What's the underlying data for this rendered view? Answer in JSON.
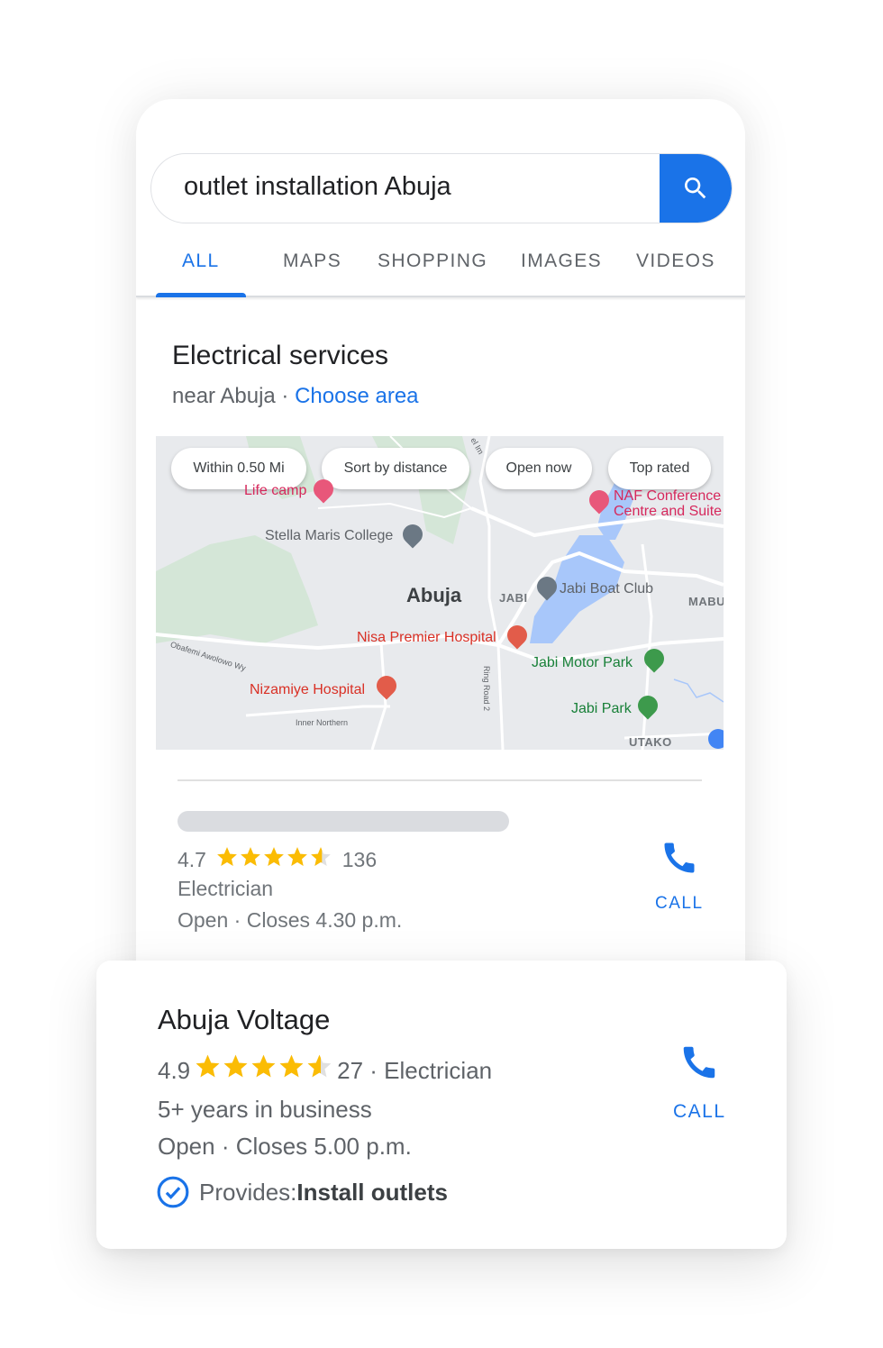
{
  "search": {
    "query": "outlet installation Abuja",
    "button_icon": "search-icon"
  },
  "tabs": [
    {
      "label": "ALL",
      "active": true
    },
    {
      "label": "MAPS",
      "active": false
    },
    {
      "label": "SHOPPING",
      "active": false
    },
    {
      "label": "IMAGES",
      "active": false
    },
    {
      "label": "VIDEOS",
      "active": false
    }
  ],
  "section": {
    "title": "Electrical services",
    "near_text": "near Abuja · ",
    "choose_area": "Choose area"
  },
  "map": {
    "chips": [
      "Within 0.50 Mi",
      "Sort by distance",
      "Open now",
      "Top rated"
    ],
    "places": {
      "life_camp": "Life camp",
      "naf_line1": "NAF Conference",
      "naf_line2": "Centre and Suite",
      "stella": "Stella Maris College",
      "abuja": "Abuja",
      "jabi": "JABI",
      "jabi_boat": "Jabi Boat Club",
      "mabu": "MABU",
      "nisa": "Nisa Premier Hospital",
      "jabi_motor": "Jabi Motor Park",
      "nizamiye": "Nizamiye Hospital",
      "jabi_park": "Jabi Park",
      "utako": "UTAKO",
      "obafemi": "Obafemi Awolowo Wy",
      "inner_northern": "Inner Northern",
      "ring_road": "Ring Road 2",
      "road_top": "el Im"
    },
    "colors": {
      "land": "#e8eaed",
      "park": "#d4e6d7",
      "water": "#a8c7fa",
      "road": "#ffffff"
    }
  },
  "listing1": {
    "rating": "4.7",
    "stars": 4.7,
    "reviews": "136",
    "category": "Electrician",
    "hours": "Open · Closes 4.30 p.m.",
    "call_label": "CALL"
  },
  "listing2": {
    "name": "Abuja Voltage",
    "rating": "4.9",
    "stars": 4.9,
    "reviews_category": "27 · Electrician",
    "years": "5+ years in business",
    "hours": "Open · Closes 5.00 p.m.",
    "provides_label": "Provides: ",
    "provides_value": "Install outlets",
    "call_label": "CALL"
  },
  "colors": {
    "accent": "#1a73e8",
    "star": "#fbbc04",
    "text_primary": "#202124",
    "text_secondary": "#5f6368"
  }
}
